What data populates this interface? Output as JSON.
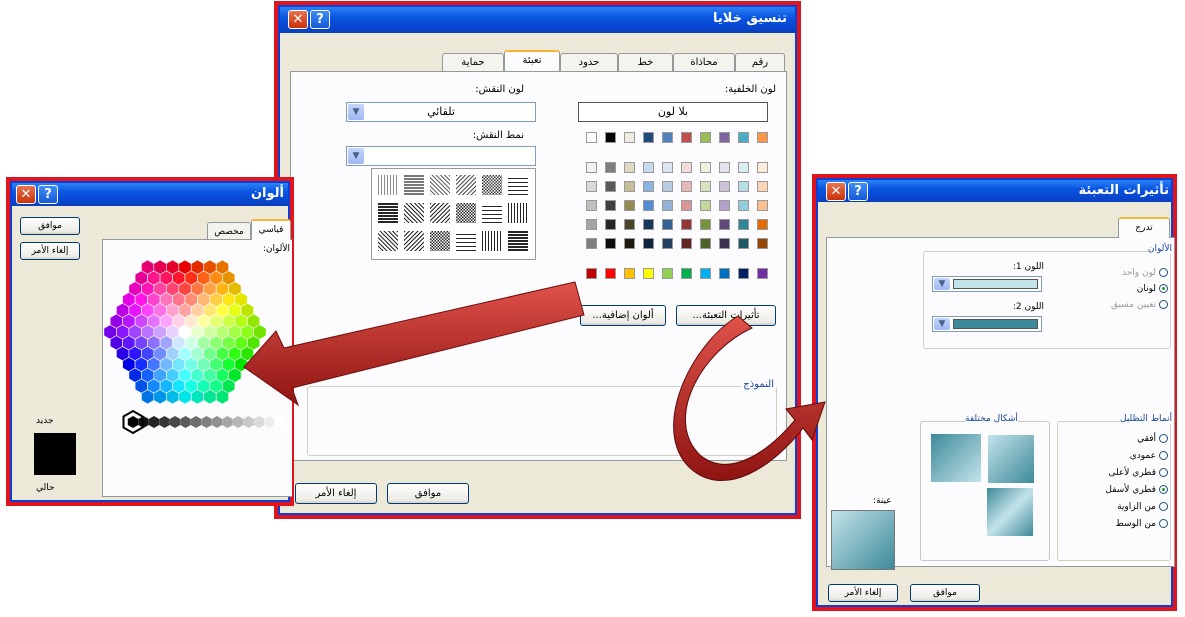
{
  "format_cells": {
    "title": "تنسيق خلايا",
    "tabs": [
      "رقم",
      "محاذاة",
      "خط",
      "حدود",
      "تعبئة",
      "حماية"
    ],
    "active_tab": "تعبئة",
    "bg_color_label": "لون الخلفية:",
    "no_color": "بلا لون",
    "pattern_color_label": "لون النقش:",
    "pattern_color_value": "تلقائي",
    "pattern_style_label": "نمط النقش:",
    "fill_effects_button": "تأثيرات التعبئة...",
    "more_colors_button": "ألوان إضافية...",
    "sample_label": "النموذج",
    "ok": "موافق",
    "cancel": "إلغاء الأمر",
    "theme_row": [
      "#f79646",
      "#4bacc6",
      "#8064a2",
      "#9bbb59",
      "#c0504d",
      "#4f81bd",
      "#1f497d",
      "#eeece1",
      "#000000",
      "#ffffff"
    ],
    "shade_grid": [
      [
        "#fdeada",
        "#dbeef3",
        "#e5e0ec",
        "#ebf1dd",
        "#f2dcdb",
        "#dbe5f1",
        "#c6d9f0",
        "#ddd9c3",
        "#7f7f7f",
        "#f2f2f2"
      ],
      [
        "#fbd5b5",
        "#b7dde8",
        "#ccc1d9",
        "#d7e3bc",
        "#e5b9b7",
        "#b8cce4",
        "#8db3e2",
        "#c4bd97",
        "#595959",
        "#d8d8d8"
      ],
      [
        "#fac08f",
        "#92cddc",
        "#b2a2c7",
        "#c3d69b",
        "#d99694",
        "#95b3d7",
        "#548dd4",
        "#938953",
        "#3f3f3f",
        "#bfbfbf"
      ],
      [
        "#e36c09",
        "#31859b",
        "#5f497a",
        "#76923c",
        "#953734",
        "#366092",
        "#17365d",
        "#494429",
        "#262626",
        "#a5a5a5"
      ],
      [
        "#974806",
        "#205867",
        "#3f3151",
        "#4f6128",
        "#632423",
        "#244061",
        "#0f243e",
        "#1d1b10",
        "#0c0c0c",
        "#7f7f7f"
      ]
    ],
    "standard_row": [
      "#7030a0",
      "#002060",
      "#0070c0",
      "#00b0f0",
      "#00b050",
      "#92d050",
      "#ffff00",
      "#ffc000",
      "#ff0000",
      "#c00000"
    ]
  },
  "colors_dialog": {
    "title": "ألوان",
    "tabs": [
      "قياسي",
      "مخصص"
    ],
    "colors_label": "الألوان:",
    "ok": "موافق",
    "cancel": "إلغاء الأمر",
    "new_label": "جديد",
    "current_label": "حالي"
  },
  "fill_effects": {
    "title": "تأثيرات التعبئة",
    "tab": "تدرج",
    "colors_group": "الألوان",
    "one_color": "لون واحد",
    "two_colors": "لونان",
    "preset": "تعيين مسبق",
    "color1_label": "اللون 1:",
    "color2_label": "اللون 2:",
    "color1": "#c3e3ea",
    "color2": "#3d8a99",
    "shading_group": "أنماط التظليل",
    "variants_label": "أشكال مختلفة",
    "styles": [
      "أفقي",
      "عمودي",
      "قطري لأعلى",
      "قطري لأسفل",
      "من الزاوية",
      "من الوسط"
    ],
    "selected_style": "قطري لأسفل",
    "sample_label": "عينة:",
    "ok": "موافق",
    "cancel": "إلغاء الأمر"
  },
  "accent": {
    "frame": "#e0141c",
    "arrow": "#b8211e",
    "titlebar": "#0a55e0"
  }
}
